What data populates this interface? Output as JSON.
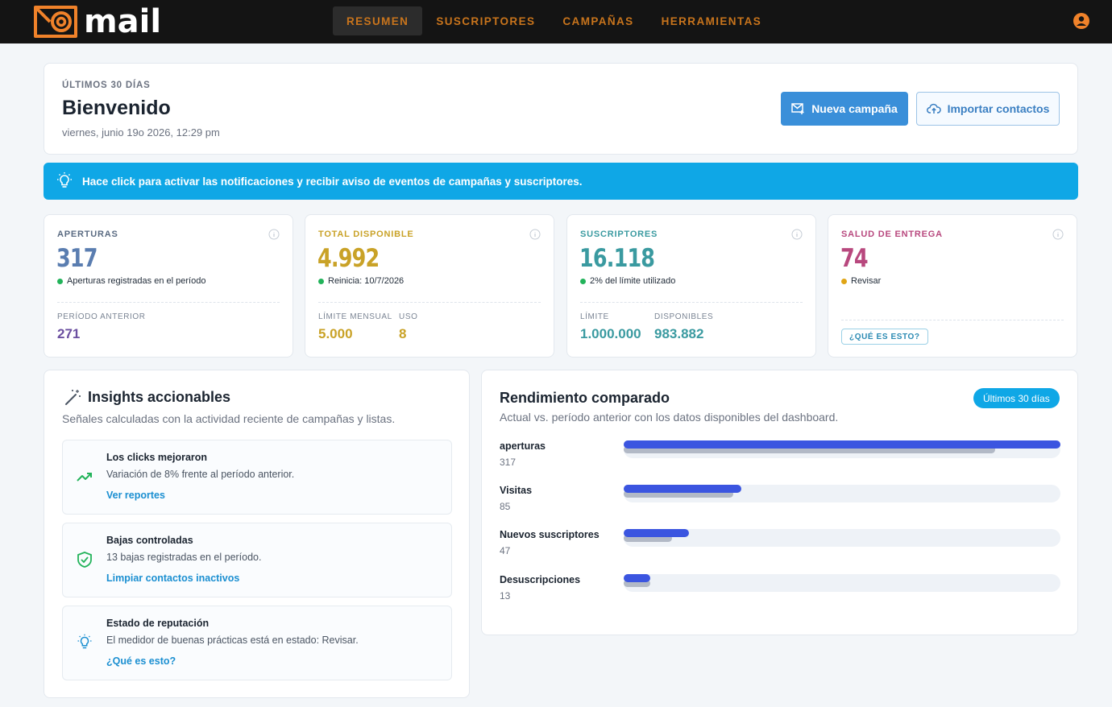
{
  "app": {
    "logo_text": "mail"
  },
  "nav": {
    "items": [
      "RESUMEN",
      "SUSCRIPTORES",
      "CAMPAÑAS",
      "HERRAMIENTAS"
    ],
    "active": 0
  },
  "welcome": {
    "eyebrow": "ÚLTIMOS 30 DÍAS",
    "title": "Bienvenido",
    "date": "viernes, junio 19o 2026, 12:29 pm",
    "primary_button": "Nueva campaña",
    "secondary_button": "Importar contactos"
  },
  "alert": {
    "text": "Hace click para activar las notificaciones y recibir aviso de eventos de campañas y suscriptores."
  },
  "stats": [
    {
      "label": "APERTURAS",
      "value": "317",
      "note": "Aperturas registradas en el período",
      "note_color": "#22b35a",
      "color": "#5a7db0",
      "sub_label_1": "PERÍODO ANTERIOR",
      "sub_value_1": "271",
      "sub_color": "#6b4fa0"
    },
    {
      "label": "TOTAL DISPONIBLE",
      "value": "4.992",
      "note": "Reinicia: 10/7/2026",
      "note_color": "#22b35a",
      "color": "#c9a227",
      "sub_label_1": "LÍMITE MENSUAL",
      "sub_value_1": "5.000",
      "sub_label_2": "USO",
      "sub_value_2": "8",
      "sub_color": "#c9a227"
    },
    {
      "label": "SUSCRIPTORES",
      "value": "16.118",
      "note": "2% del límite utilizado",
      "note_color": "#22b35a",
      "color": "#3a9aa0",
      "sub_label_1": "LÍMITE",
      "sub_value_1": "1.000.000",
      "sub_label_2": "DISPONIBLES",
      "sub_value_2": "983.882",
      "sub_color": "#3a9aa0"
    },
    {
      "label": "SALUD DE ENTREGA",
      "value": "74",
      "note": "Revisar",
      "note_color": "#e0a516",
      "color": "#b8487e",
      "help_chip": "¿QUÉ ES ESTO?"
    }
  ],
  "insights": {
    "title": "Insights accionables",
    "subtitle": "Señales calculadas con la actividad reciente de campañas y listas.",
    "items": [
      {
        "title": "Los clicks mejoraron",
        "description": "Variación de 8% frente al período anterior.",
        "link": "Ver reportes",
        "icon": "trending-up-icon"
      },
      {
        "title": "Bajas controladas",
        "description": "13 bajas registradas en el período.",
        "link": "Limpiar contactos inactivos",
        "icon": "shield-check-icon"
      },
      {
        "title": "Estado de reputación",
        "description": "El medidor de buenas prácticas está en estado: Revisar.",
        "link": "¿Qué es esto?",
        "icon": "lightbulb-icon"
      }
    ]
  },
  "performance": {
    "title": "Rendimiento comparado",
    "subtitle": "Actual vs. período anterior con los datos disponibles del dashboard.",
    "badge": "Últimos 30 días",
    "rows": [
      {
        "label": "aperturas",
        "value": "317",
        "current_fraction": 1.0,
        "previous_fraction": 0.85
      },
      {
        "label": "Visitas",
        "value": "85",
        "current_fraction": 0.27,
        "previous_fraction": 0.25
      },
      {
        "label": "Nuevos suscriptores",
        "value": "47",
        "current_fraction": 0.15,
        "previous_fraction": 0.11
      },
      {
        "label": "Desuscripciones",
        "value": "13",
        "current_fraction": 0.06,
        "previous_fraction": 0.06
      }
    ]
  },
  "colors": {
    "brand_orange": "#f0822a",
    "accent_blue": "#0fa7e6",
    "bar_current": "#3b55e0",
    "bar_previous": "#b2b9c6"
  }
}
